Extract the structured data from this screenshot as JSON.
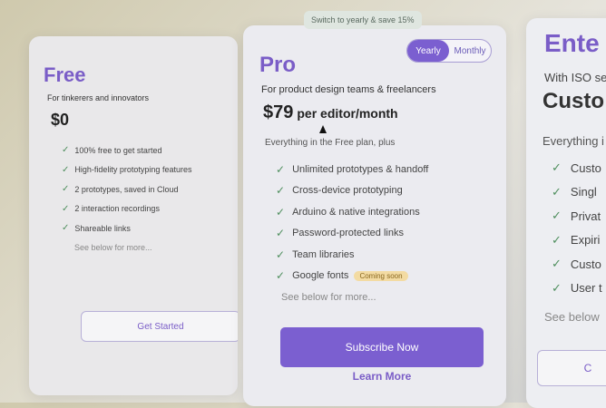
{
  "switch_note": "Switch to yearly & save 15%",
  "free": {
    "name": "Free",
    "tagline": "For tinkerers and innovators",
    "price": "$0",
    "features": [
      "100% free to get started",
      "High-fidelity prototyping features",
      "2 prototypes, saved in Cloud",
      "2 interaction recordings",
      "Shareable links"
    ],
    "more": "See below for more...",
    "cta": "Get Started"
  },
  "pro": {
    "name": "Pro",
    "toggle": {
      "yearly": "Yearly",
      "monthly": "Monthly",
      "selected": "Yearly"
    },
    "tagline": "For product design teams & freelancers",
    "price": "$79",
    "price_unit": "per editor/month",
    "intro": "Everything in the Free plan, plus",
    "features": [
      "Unlimited prototypes & handoff",
      "Cross-device prototyping",
      "Arduino & native integrations",
      "Password-protected links",
      "Team libraries",
      "Google fonts"
    ],
    "badge": "Coming soon",
    "more": "See below for more...",
    "cta_primary": "Subscribe Now",
    "cta_secondary": "Learn More"
  },
  "enterprise": {
    "name": "Ente",
    "tagline": "With ISO se",
    "price": "Custo",
    "intro": "Everything i",
    "features": [
      "Custo",
      "Singl",
      "Privat",
      "Expiri",
      "Custo",
      "User t"
    ],
    "more": "See below",
    "cta": "C"
  },
  "colors": {
    "accent": "#7b5fd0",
    "check": "#4f8f5e",
    "badge_bg": "#f3dba3"
  }
}
